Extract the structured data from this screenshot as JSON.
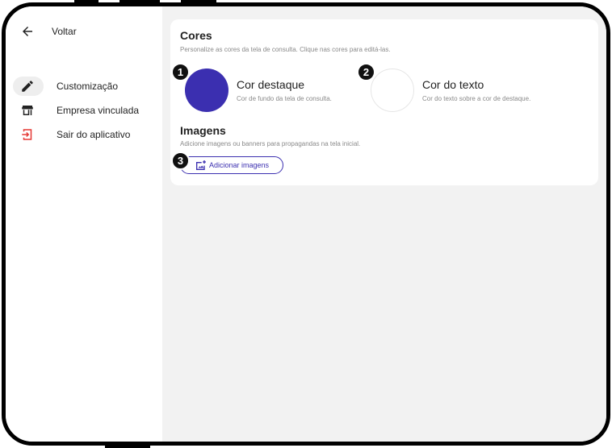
{
  "sidebar": {
    "back_label": "Voltar",
    "items": [
      {
        "label": "Customização",
        "icon": "pencil-icon",
        "active": true
      },
      {
        "label": "Empresa vinculada",
        "icon": "store-icon",
        "active": false
      },
      {
        "label": "Sair do aplicativo",
        "icon": "logout-icon",
        "active": false
      }
    ]
  },
  "cores": {
    "title": "Cores",
    "subtitle": "Personalize as cores da tela de consulta. Clique nas cores para editá-las.",
    "accent": {
      "name": "Cor destaque",
      "desc": "Cor de fundo da tela de consulta.",
      "color": "#3b2fb0",
      "badge": "1"
    },
    "text": {
      "name": "Cor do texto",
      "desc": "Cor do texto sobre a cor de destaque.",
      "color": "#ffffff",
      "badge": "2"
    }
  },
  "imagens": {
    "title": "Imagens",
    "subtitle": "Adicione imagens ou banners para propagandas na tela inicial.",
    "add_button": "Adicionar imagens",
    "badge": "3"
  },
  "colors": {
    "accent": "#3b2fb0",
    "danger": "#e53935",
    "main_bg": "#f2f2f2"
  }
}
